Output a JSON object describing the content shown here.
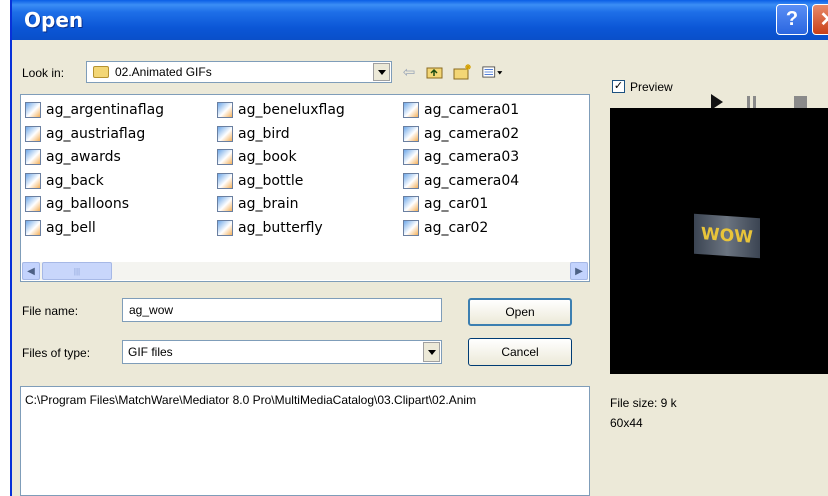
{
  "dialog": {
    "title": "Open"
  },
  "look_in": {
    "label": "Look in:",
    "folder": "02.Animated GIFs"
  },
  "files": [
    "ag_argentinaflag",
    "ag_austriaflag",
    "ag_awards",
    "ag_back",
    "ag_balloons",
    "ag_bell",
    "ag_beneluxflag",
    "ag_bird",
    "ag_book",
    "ag_bottle",
    "ag_brain",
    "ag_butterfly",
    "ag_camera01",
    "ag_camera02",
    "ag_camera03",
    "ag_camera04",
    "ag_car01",
    "ag_car02"
  ],
  "file_name": {
    "label": "File name:",
    "value": "ag_wow"
  },
  "file_type": {
    "label": "Files of type:",
    "value": "GIF files"
  },
  "buttons": {
    "open": "Open",
    "cancel": "Cancel"
  },
  "path": "C:\\Program Files\\MatchWare\\Mediator 8.0 Pro\\MultiMediaCatalog\\03.Clipart\\02.Anim",
  "preview": {
    "checkbox_label": "Preview",
    "checked": true,
    "image_text": "WOW",
    "file_size": "File size:  9 k",
    "dimensions": "60x44"
  },
  "colors": {
    "titlebar": "#0a5ee6",
    "close": "#c94018",
    "preview_bg": "#000000"
  }
}
